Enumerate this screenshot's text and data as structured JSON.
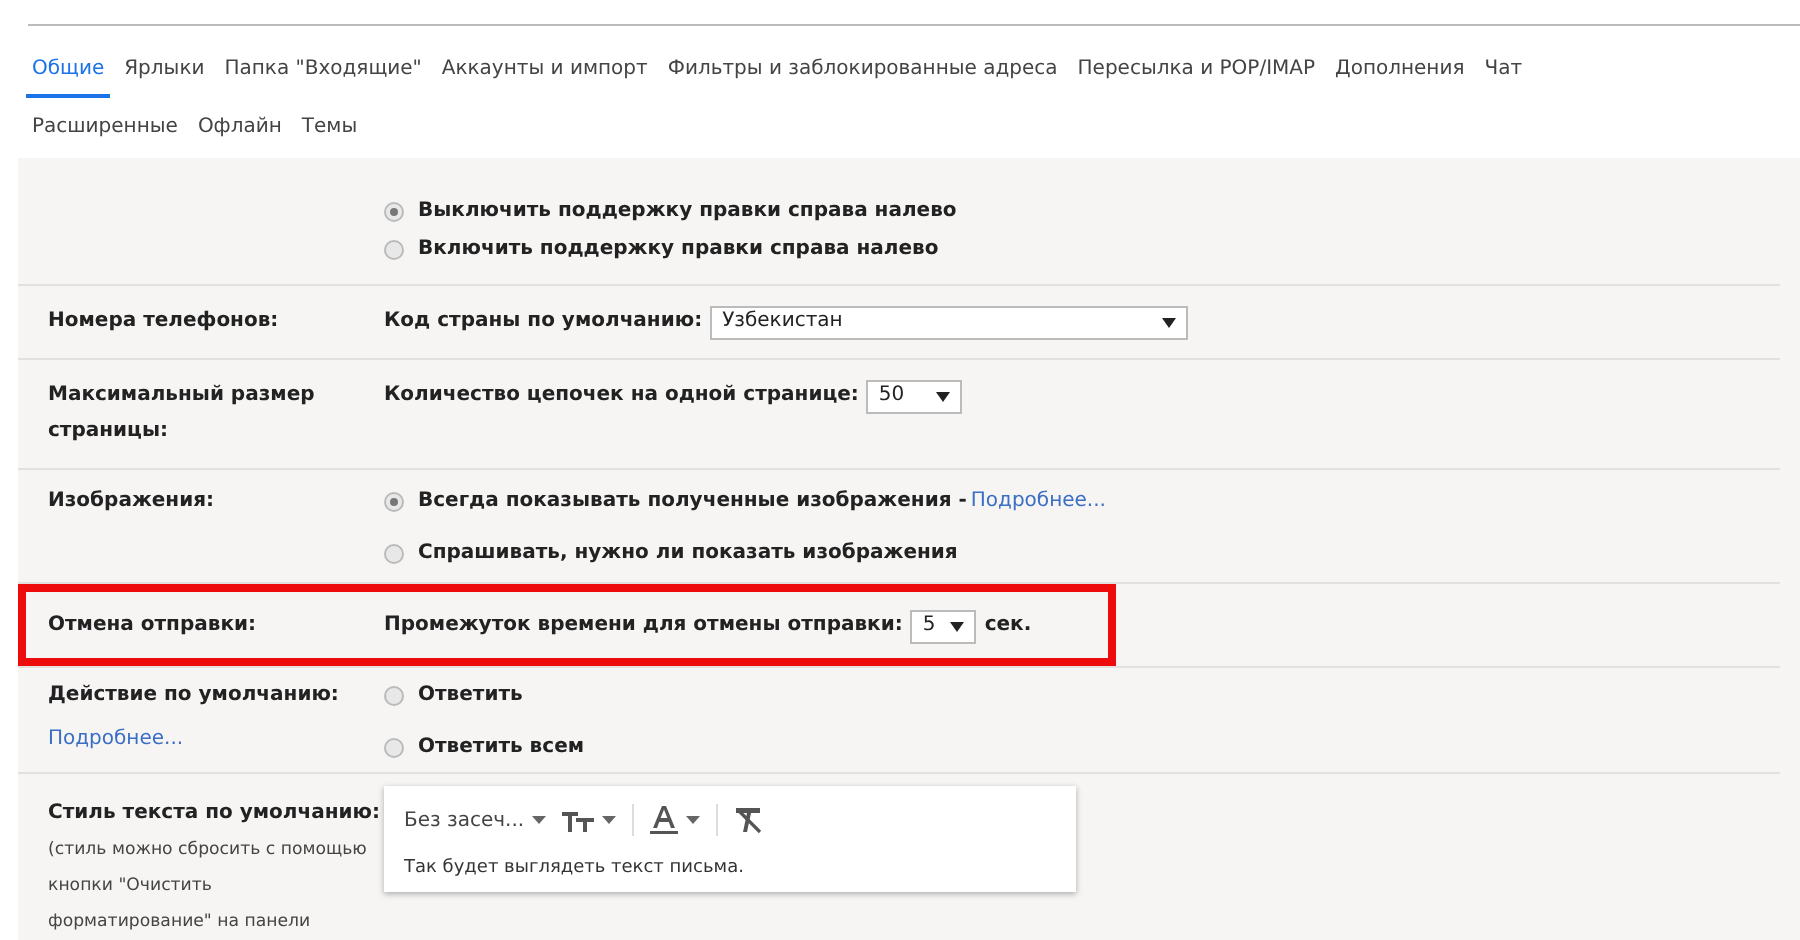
{
  "tab_rows": [
    [
      {
        "label": "Общие",
        "selected": true
      },
      {
        "label": "Ярлыки",
        "selected": false
      },
      {
        "label": "Папка \"Входящие\"",
        "selected": false
      },
      {
        "label": "Аккаунты и импорт",
        "selected": false
      },
      {
        "label": "Фильтры и заблокированные адреса",
        "selected": false
      },
      {
        "label": "Пересылка и POP/IMAP",
        "selected": false
      },
      {
        "label": "Дополнения",
        "selected": false
      },
      {
        "label": "Чат",
        "selected": false
      }
    ],
    [
      {
        "label": "Расширенные",
        "selected": false
      },
      {
        "label": "Офлайн",
        "selected": false
      },
      {
        "label": "Темы",
        "selected": false
      }
    ]
  ],
  "settings": [
    {
      "kind": "radio",
      "options": [
        {
          "text": "Выключить поддержку правки справа налево",
          "selected": true
        },
        {
          "text": "Включить поддержку правки справа налево",
          "selected": false
        }
      ]
    },
    {
      "kind": "select",
      "label": "Номера телефонов:",
      "prefix": "Код страны по умолчанию:",
      "value": "Узбекистан"
    },
    {
      "kind": "select",
      "label": "Максимальный размер страницы:",
      "prefix": "Количество цепочек на одной странице:",
      "value": "50"
    },
    {
      "kind": "radio",
      "label": "Изображения:",
      "options": [
        {
          "text": "Всегда показывать полученные изображения - ",
          "link": "Подробнее...",
          "selected": true
        },
        {
          "text": "Спрашивать, нужно ли показать изображения",
          "selected": false
        }
      ]
    },
    {
      "kind": "select",
      "label": "Отмена отправки:",
      "prefix": "Промежуток времени для отмены отправки:",
      "value": "5",
      "suffix": "сек.",
      "highlighted": true
    },
    {
      "kind": "radio",
      "label": "Действие по умолчанию:",
      "label_link": "Подробнее...",
      "options": [
        {
          "text": "Ответить",
          "selected": false
        },
        {
          "text": "Ответить всем",
          "selected": false
        }
      ]
    },
    {
      "kind": "editor",
      "label": "Стиль текста по умолчанию:",
      "note_lines": [
        "(стиль можно сбросить с помощью",
        "кнопки \"Очистить",
        "форматирование\" на панели"
      ],
      "font": "Без засеч...",
      "preview": "Так будет выглядеть текст письма."
    }
  ]
}
